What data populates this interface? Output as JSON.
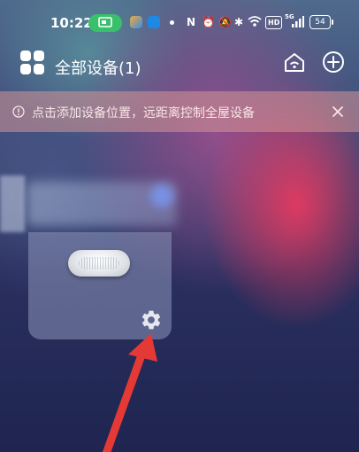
{
  "status_bar": {
    "time": "10:22",
    "network_type": "5G",
    "hd_badge": "HD",
    "battery": "54"
  },
  "header": {
    "title": "全部设备(1)",
    "apps_icon": "grid-apps-icon",
    "home_icon": "home-wifi-icon",
    "add_icon": "plus-circle-icon"
  },
  "banner": {
    "text": "点击添加设备位置，远距离控制全屋设备",
    "icon": "info-circle-icon",
    "close_icon": "close-icon"
  },
  "device_card": {
    "settings_icon": "gear-icon"
  },
  "colors": {
    "accent_green": "#39c06a",
    "banner_bg": "#d69696",
    "annotation_arrow": "#e53935"
  }
}
